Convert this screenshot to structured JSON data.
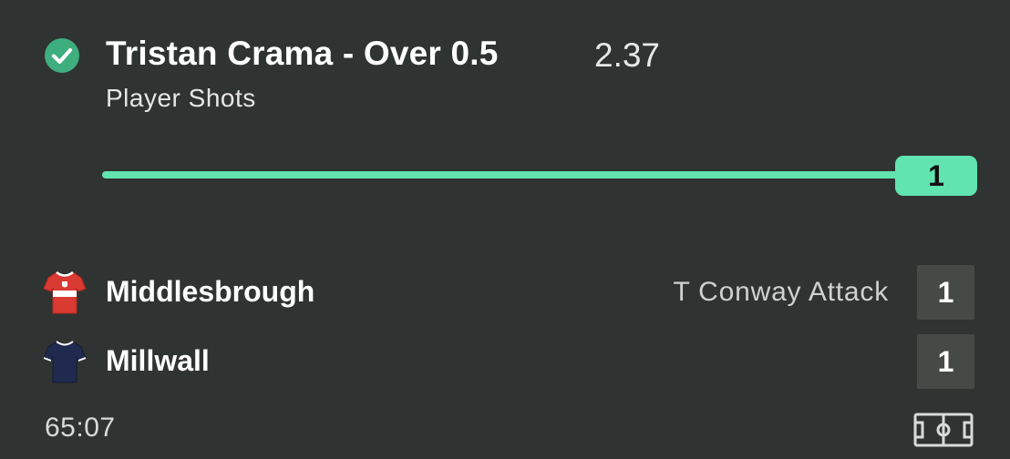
{
  "bet": {
    "title": "Tristan Crama - Over 0.5",
    "odds": "2.37",
    "market": "Player Shots",
    "status_icon": "check-circle-icon",
    "status_color": "#3fae7f"
  },
  "progress": {
    "value": 1,
    "fraction": 1.0,
    "badge_label": "1",
    "accent_color": "#62e4b0"
  },
  "match": {
    "home": {
      "name": "Middlesbrough",
      "score": "1",
      "icon": "red-shirt-icon",
      "status": "T Conway Attack"
    },
    "away": {
      "name": "Millwall",
      "score": "1",
      "icon": "navy-shirt-icon"
    },
    "time": "65:07",
    "pitch_icon": "pitch-icon"
  }
}
